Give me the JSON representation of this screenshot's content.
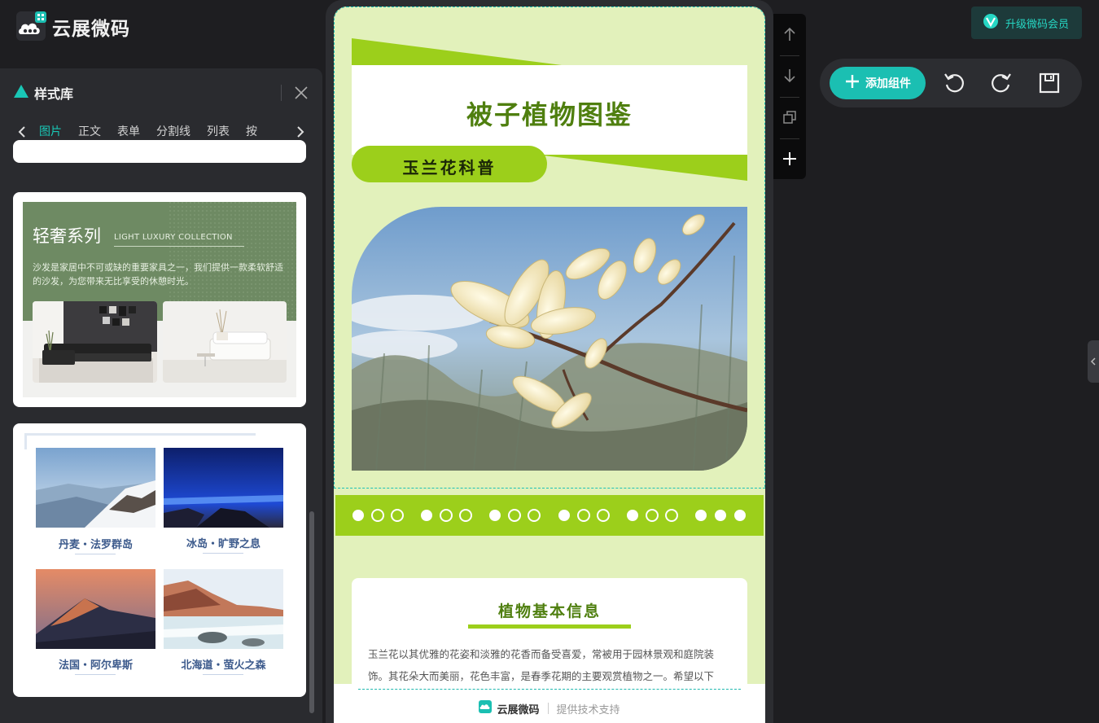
{
  "app": {
    "brand": "云展微码"
  },
  "panel": {
    "title": "样式库",
    "tabs": [
      {
        "label": "图片",
        "active": true
      },
      {
        "label": "正文"
      },
      {
        "label": "表单"
      },
      {
        "label": "分割线"
      },
      {
        "label": "列表"
      },
      {
        "label": "按"
      }
    ]
  },
  "templates": {
    "luxury": {
      "title": "轻奢系列",
      "subtitle": "LIGHT LUXURY COLLECTION",
      "description": "沙发是家居中不可或缺的重要家具之一，我们提供一款柔软舒适的沙发，为您带来无比享受的休憩时光。"
    },
    "travel": [
      {
        "caption": "丹麦・法罗群岛"
      },
      {
        "caption": "冰岛・旷野之息"
      },
      {
        "caption": "法国・阿尔卑斯"
      },
      {
        "caption": "北海道・萤火之森"
      }
    ]
  },
  "canvas": {
    "title": "被子植物图鉴",
    "pill": "玉兰花科普",
    "info_title": "植物基本信息",
    "info_text": "玉兰花以其优雅的花姿和淡雅的花香而备受喜爱，常被用于园林景观和庭院装饰。其花朵大而美丽，花色丰富，是春季花期的主要观赏植物之一。希望以下",
    "footer_brand": "云展微码",
    "footer_support": "提供技术支持"
  },
  "toolbar": {
    "upgrade_label": "升级微码会员",
    "add_component_label": "添加组件"
  },
  "colors": {
    "accent": "#1bbfb2",
    "green": "#9ccf1b",
    "dark_green": "#4f7f0f",
    "canvas_bg": "#e2f1bb"
  }
}
